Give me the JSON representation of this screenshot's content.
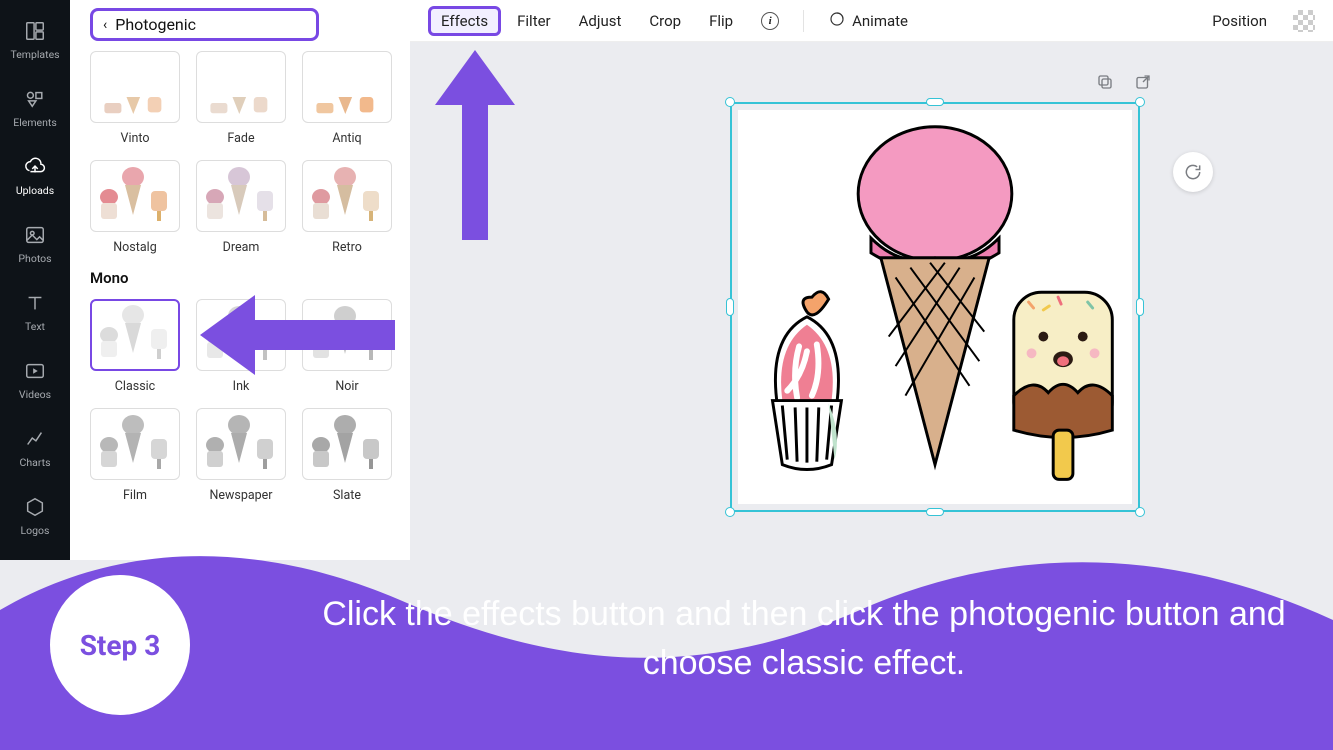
{
  "rail": {
    "items": [
      {
        "label": "Templates",
        "icon": "templates"
      },
      {
        "label": "Elements",
        "icon": "elements"
      },
      {
        "label": "Uploads",
        "icon": "uploads",
        "active": true
      },
      {
        "label": "Photos",
        "icon": "photos"
      },
      {
        "label": "Text",
        "icon": "text"
      },
      {
        "label": "Videos",
        "icon": "videos"
      },
      {
        "label": "Charts",
        "icon": "charts"
      },
      {
        "label": "Logos",
        "icon": "logos"
      }
    ]
  },
  "panel": {
    "back_label": "Photogenic",
    "row1": [
      {
        "label": "Vinto",
        "variant": "cropped"
      },
      {
        "label": "Fade",
        "variant": "cropped"
      },
      {
        "label": "Antiq",
        "variant": "cropped"
      }
    ],
    "row2": [
      {
        "label": "Nostalg",
        "variant": "p1"
      },
      {
        "label": "Dream",
        "variant": "p2"
      },
      {
        "label": "Retro",
        "variant": "p3"
      }
    ],
    "section2_title": "Mono",
    "row3": [
      {
        "label": "Classic",
        "variant": "m1",
        "selected": true
      },
      {
        "label": "Ink",
        "variant": "m1"
      },
      {
        "label": "Noir",
        "variant": "m1"
      }
    ],
    "row4": [
      {
        "label": "Film",
        "variant": "m2"
      },
      {
        "label": "Newspaper",
        "variant": "m2"
      },
      {
        "label": "Slate",
        "variant": "m2"
      }
    ]
  },
  "toolbar": {
    "effects": "Effects",
    "filter": "Filter",
    "adjust": "Adjust",
    "crop": "Crop",
    "flip": "Flip",
    "animate": "Animate",
    "position": "Position"
  },
  "instruction": {
    "step_label": "Step 3",
    "text": "Click the effects button and then click the photogenic button and choose classic effect."
  },
  "colors": {
    "accent": "#7b4fe0",
    "selection": "#35c3d6"
  }
}
